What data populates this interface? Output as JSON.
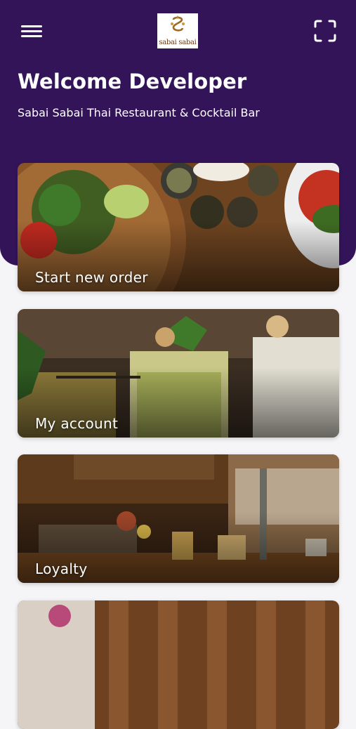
{
  "header": {
    "logo_text": "sabai sabai",
    "welcome": "Welcome Developer",
    "subtitle": "Sabai Sabai Thai Restaurant & Cocktail Bar"
  },
  "icons": {
    "menu": "hamburger-menu-icon",
    "scan": "scan-frame-icon",
    "logo": "sabai-sabai-logo"
  },
  "cards": [
    {
      "label": "Start new order",
      "image": "thai-food-platters"
    },
    {
      "label": "My account",
      "image": "cocktail-glasses"
    },
    {
      "label": "Loyalty",
      "image": "restaurant-bar-counter"
    },
    {
      "label": "",
      "image": "wooden-wall-flowers"
    }
  ],
  "colors": {
    "header": "#331459",
    "background": "#f5f4f6",
    "text_light": "#ffffff"
  }
}
